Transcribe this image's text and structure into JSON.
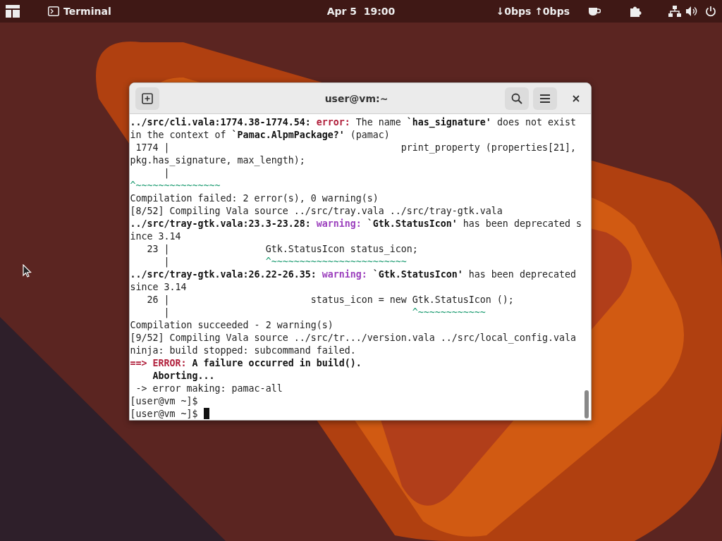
{
  "top_bar": {
    "app_name": "Terminal",
    "clock": "Apr 5  19:00",
    "net_speed": "↓0bps ↑0bps"
  },
  "window": {
    "title": "user@vm:~"
  },
  "terminal": {
    "lines": [
      {
        "segments": [
          {
            "kind": "bold",
            "text": "../src/cli.vala:1774.38-1774.54: "
          },
          {
            "kind": "error",
            "text": "error:"
          },
          {
            "kind": "plain",
            "text": " The name "
          },
          {
            "kind": "bold",
            "text": "`has_signature'"
          },
          {
            "kind": "plain",
            "text": " does not exist"
          }
        ]
      },
      {
        "segments": [
          {
            "kind": "plain",
            "text": "in the context of "
          },
          {
            "kind": "bold",
            "text": "`Pamac.AlpmPackage?'"
          },
          {
            "kind": "plain",
            "text": " (pamac)"
          }
        ]
      },
      {
        "segments": [
          {
            "kind": "plain",
            "text": " 1774 |                                         print_property (properties[21],"
          }
        ]
      },
      {
        "segments": [
          {
            "kind": "plain",
            "text": "pkg.has_signature, max_length);"
          }
        ]
      },
      {
        "segments": [
          {
            "kind": "plain",
            "text": "      |"
          }
        ]
      },
      {
        "segments": [
          {
            "kind": "hint",
            "text": "^~~~~~~~~~~~~~~~"
          }
        ]
      },
      {
        "segments": [
          {
            "kind": "plain",
            "text": "Compilation failed: 2 error(s), 0 warning(s)"
          }
        ]
      },
      {
        "segments": [
          {
            "kind": "plain",
            "text": "[8/52] Compiling Vala source ../src/tray.vala ../src/tray-gtk.vala"
          }
        ]
      },
      {
        "segments": [
          {
            "kind": "bold",
            "text": "../src/tray-gtk.vala:23.3-23.28: "
          },
          {
            "kind": "warning",
            "text": "warning:"
          },
          {
            "kind": "bold",
            "text": " `Gtk.StatusIcon'"
          },
          {
            "kind": "plain",
            "text": " has been deprecated s"
          }
        ]
      },
      {
        "segments": [
          {
            "kind": "plain",
            "text": "ince 3.14"
          }
        ]
      },
      {
        "segments": [
          {
            "kind": "plain",
            "text": "   23 |                 Gtk.StatusIcon status_icon;"
          }
        ]
      },
      {
        "segments": [
          {
            "kind": "plain",
            "text": "      |                 "
          },
          {
            "kind": "hint",
            "text": "^~~~~~~~~~~~~~~~~~~~~~~~~"
          }
        ]
      },
      {
        "segments": [
          {
            "kind": "bold",
            "text": "../src/tray-gtk.vala:26.22-26.35: "
          },
          {
            "kind": "warning",
            "text": "warning:"
          },
          {
            "kind": "bold",
            "text": " `Gtk.StatusIcon'"
          },
          {
            "kind": "plain",
            "text": " has been deprecated"
          }
        ]
      },
      {
        "segments": [
          {
            "kind": "plain",
            "text": "since 3.14"
          }
        ]
      },
      {
        "segments": [
          {
            "kind": "plain",
            "text": "   26 |                         status_icon = new Gtk.StatusIcon ();"
          }
        ]
      },
      {
        "segments": [
          {
            "kind": "plain",
            "text": "      |                                           "
          },
          {
            "kind": "hint",
            "text": "^~~~~~~~~~~~~"
          }
        ]
      },
      {
        "segments": [
          {
            "kind": "plain",
            "text": "Compilation succeeded - 2 warning(s)"
          }
        ]
      },
      {
        "segments": [
          {
            "kind": "plain",
            "text": "[9/52] Compiling Vala source ../src/tr.../version.vala ../src/local_config.vala"
          }
        ]
      },
      {
        "segments": [
          {
            "kind": "plain",
            "text": "ninja: build stopped: subcommand failed."
          }
        ]
      },
      {
        "segments": [
          {
            "kind": "error",
            "text": "==> ERROR:"
          },
          {
            "kind": "bold",
            "text": " A failure occurred in build()."
          }
        ]
      },
      {
        "segments": [
          {
            "kind": "bold",
            "text": "    Aborting..."
          }
        ]
      },
      {
        "segments": [
          {
            "kind": "plain",
            "text": " -> error making: pamac-all"
          }
        ]
      },
      {
        "segments": [
          {
            "kind": "plain",
            "text": "[user@vm ~]$ "
          }
        ]
      },
      {
        "segments": [
          {
            "kind": "plain",
            "text": "[user@vm ~]$ "
          }
        ],
        "cursor": true
      }
    ]
  }
}
